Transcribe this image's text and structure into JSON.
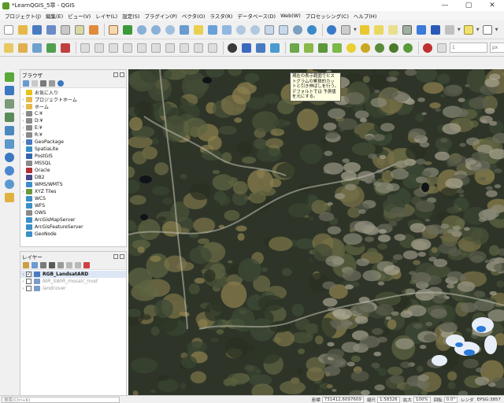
{
  "window": {
    "title": "*LearnQGIS_5章 - QGIS",
    "minimize": "—",
    "maximize": "▢",
    "close": "✕"
  },
  "menu": [
    "プロジェクト(J)",
    "編集(E)",
    "ビュー(V)",
    "レイヤ(L)",
    "設定(S)",
    "プラグイン(P)",
    "ベクタ(O)",
    "ラスタ(R)",
    "データベース(D)",
    "Web(W)",
    "プロセッシング(C)",
    "ヘルプ(H)"
  ],
  "toolbar2": {
    "band_value": "1",
    "unit": "px",
    "overflow": "»"
  },
  "browser_panel": {
    "title": "ブラウザ",
    "items": [
      {
        "label": "お気に入り",
        "indent": 0,
        "icon": "star-icon",
        "color": "#e8c21a",
        "expand": ""
      },
      {
        "label": "プロジェクトホーム",
        "indent": 0,
        "icon": "folder-icon",
        "color": "#e6b84a",
        "expand": "›"
      },
      {
        "label": "ホーム",
        "indent": 0,
        "icon": "folder-icon",
        "color": "#e6b84a",
        "expand": "›"
      },
      {
        "label": "C:¥",
        "indent": 0,
        "icon": "drive-icon",
        "color": "#8a8a8a",
        "expand": "›"
      },
      {
        "label": "D:¥",
        "indent": 0,
        "icon": "drive-icon",
        "color": "#8a8a8a",
        "expand": "›"
      },
      {
        "label": "E:¥",
        "indent": 0,
        "icon": "drive-icon",
        "color": "#8a8a8a",
        "expand": "›"
      },
      {
        "label": "R:¥",
        "indent": 0,
        "icon": "drive-icon",
        "color": "#8a8a8a",
        "expand": "›"
      },
      {
        "label": "GeoPackage",
        "indent": 0,
        "icon": "geopackage-icon",
        "color": "#4a7abf",
        "expand": "›"
      },
      {
        "label": "SpatiaLite",
        "indent": 0,
        "icon": "spatialite-icon",
        "color": "#3c8fc7",
        "expand": ""
      },
      {
        "label": "PostGIS",
        "indent": 0,
        "icon": "postgis-icon",
        "color": "#3266a8",
        "expand": ""
      },
      {
        "label": "MSSQL",
        "indent": 0,
        "icon": "mssql-icon",
        "color": "#8a8a8a",
        "expand": ""
      },
      {
        "label": "Oracle",
        "indent": 0,
        "icon": "oracle-icon",
        "color": "#b03030",
        "expand": ""
      },
      {
        "label": "DB2",
        "indent": 0,
        "icon": "db2-icon",
        "color": "#4a4a8a",
        "expand": ""
      },
      {
        "label": "WMS/WMTS",
        "indent": 0,
        "icon": "wms-icon",
        "color": "#3c8fc7",
        "expand": ""
      },
      {
        "label": "XYZ Tiles",
        "indent": 0,
        "icon": "xyz-tiles-icon",
        "color": "#6a9a3a",
        "expand": "›"
      },
      {
        "label": "WCS",
        "indent": 0,
        "icon": "wcs-icon",
        "color": "#3c8fc7",
        "expand": ""
      },
      {
        "label": "WFS",
        "indent": 0,
        "icon": "wfs-icon",
        "color": "#3c8fc7",
        "expand": ""
      },
      {
        "label": "OWS",
        "indent": 0,
        "icon": "ows-icon",
        "color": "#8a8a8a",
        "expand": ""
      },
      {
        "label": "ArcGisMapServer",
        "indent": 0,
        "icon": "arcgis-icon",
        "color": "#3c8fc7",
        "expand": ""
      },
      {
        "label": "ArcGisFeatureServer",
        "indent": 0,
        "icon": "arcgis-icon",
        "color": "#3c8fc7",
        "expand": ""
      },
      {
        "label": "GeoNode",
        "indent": 0,
        "icon": "geonode-icon",
        "color": "#3c8fc7",
        "expand": ""
      }
    ]
  },
  "layers_panel": {
    "title": "レイヤー",
    "items": [
      {
        "label": "RGB_LandsatARD",
        "checked": true,
        "selected": true,
        "dim": false,
        "color": "#4a7ac0"
      },
      {
        "label": "NIR_SWIR_mosaic_mod",
        "checked": false,
        "selected": false,
        "dim": true,
        "color": "#7a9ac8"
      },
      {
        "label": "landcover",
        "checked": false,
        "selected": false,
        "dim": true,
        "color": "#7a9ac8"
      }
    ]
  },
  "tooltip": {
    "text": "現在の表示範囲でヒストグラムの累積的カットと引き伸ばしを行う。デフォルトでは 予測値を元にする。"
  },
  "statusbar": {
    "search_placeholder": "検索(Ctrl+K)",
    "coordinate_label": "座標",
    "coordinate_value": "731412,6097609",
    "scale_label": "縮尺",
    "scale_value": "1:58326",
    "magnifier_label": "拡大",
    "magnifier_value": "100%",
    "rotation_label": "回転",
    "rotation_value": "0.0°",
    "render_label": "レンダ",
    "crs_value": "EPSG:3857"
  },
  "colors": {
    "accent": "#4a7ac0",
    "map_background": "#2e3528"
  }
}
